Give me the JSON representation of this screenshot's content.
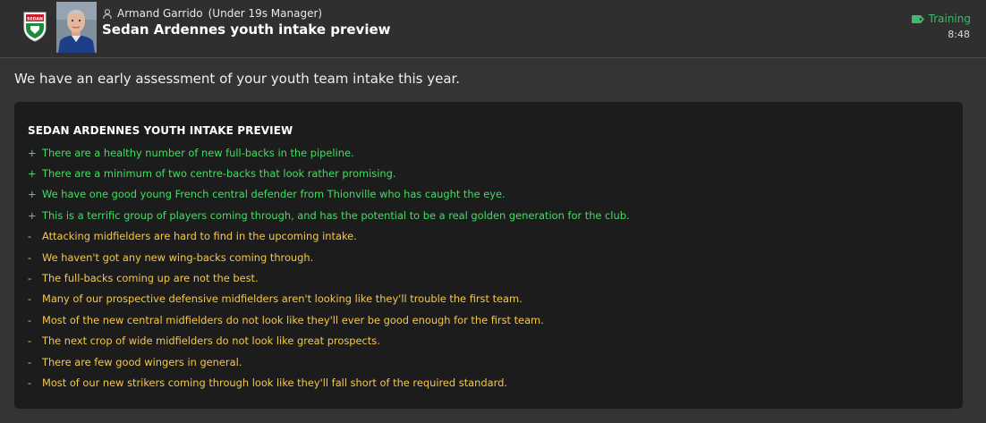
{
  "colors": {
    "positive": "#3ee061",
    "negative": "#f5c84a",
    "category": "#3fba6f"
  },
  "header": {
    "club_crest_text": "SEDAN",
    "sender_name": "Armand Garrido",
    "sender_role": "(Under 19s Manager)",
    "subject": "Sedan Ardennes youth intake preview",
    "category": "Training",
    "category_icon": "tag-icon",
    "time": "8:48"
  },
  "body": {
    "intro": "We have an early assessment of your youth team intake this year.",
    "panel_title": "SEDAN ARDENNES YOUTH INTAKE PREVIEW",
    "lines": [
      {
        "sign": "+",
        "kind": "positive",
        "text": "There are a healthy number of new full-backs in the pipeline."
      },
      {
        "sign": "+",
        "kind": "positive",
        "text": "There are a minimum of two centre-backs that look rather promising."
      },
      {
        "sign": "+",
        "kind": "positive",
        "text": "We have one good young French central defender from Thionville who has caught the eye."
      },
      {
        "sign": "+",
        "kind": "positive",
        "text": "This is a terrific group of players coming through, and has the potential to be a real golden generation for the club."
      },
      {
        "sign": "-",
        "kind": "negative",
        "text": "Attacking midfielders are hard to find in the upcoming intake."
      },
      {
        "sign": "-",
        "kind": "negative",
        "text": "We haven't got any new wing-backs coming through."
      },
      {
        "sign": "-",
        "kind": "negative",
        "text": "The full-backs coming up are not the best."
      },
      {
        "sign": "-",
        "kind": "negative",
        "text": "Many of our prospective defensive midfielders aren't looking like they'll trouble the first team."
      },
      {
        "sign": "-",
        "kind": "negative",
        "text": "Most of the new central midfielders do not look like they'll ever be good enough for the first team."
      },
      {
        "sign": "-",
        "kind": "negative",
        "text": "The next crop of wide midfielders do not look like great prospects."
      },
      {
        "sign": "-",
        "kind": "negative",
        "text": "There are few good wingers in general."
      },
      {
        "sign": "-",
        "kind": "negative",
        "text": "Most of our new strikers coming through look like they'll fall short of the required standard."
      }
    ]
  }
}
